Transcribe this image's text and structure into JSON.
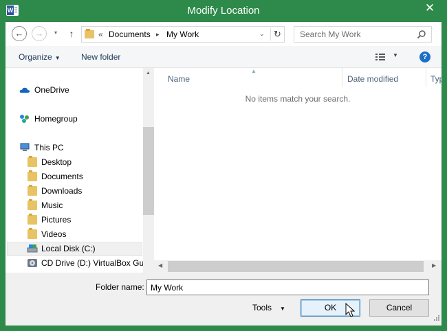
{
  "window": {
    "title": "Modify Location",
    "close_glyph": "✕",
    "app_icon": "word-icon",
    "accent": "#2e8a4a"
  },
  "navbar": {
    "back_glyph": "←",
    "forward_glyph": "→",
    "recent_glyph": "▾",
    "up_glyph": "↑",
    "address": {
      "chevron": "«",
      "crumb1": "Documents",
      "separator": "▸",
      "crumb2": "My Work",
      "dropdown_glyph": "⌄",
      "refresh_glyph": "↻"
    },
    "search": {
      "placeholder": "Search My Work"
    }
  },
  "toolbar": {
    "organize_label": "Organize",
    "caret": "▼",
    "new_folder_label": "New folder",
    "view_caret": "▼",
    "help_glyph": "?"
  },
  "nav_items": [
    {
      "label": "OneDrive",
      "icon": "cloud-icon"
    },
    {
      "label": "Homegroup",
      "icon": "homegroup-icon"
    },
    {
      "label": "This PC",
      "icon": "computer-icon"
    },
    {
      "label": "Desktop",
      "icon": "folder-icon"
    },
    {
      "label": "Documents",
      "icon": "folder-icon"
    },
    {
      "label": "Downloads",
      "icon": "folder-icon"
    },
    {
      "label": "Music",
      "icon": "folder-icon"
    },
    {
      "label": "Pictures",
      "icon": "folder-icon"
    },
    {
      "label": "Videos",
      "icon": "folder-icon"
    },
    {
      "label": "Local Disk (C:)",
      "icon": "drive-icon"
    },
    {
      "label": "CD Drive (D:) VirtualBox Gue",
      "icon": "cd-drive-icon"
    }
  ],
  "file_list": {
    "columns": [
      "Name",
      "Date modified",
      "Typ"
    ],
    "empty_message": "No items match your search."
  },
  "bottom": {
    "folder_name_label": "Folder name:",
    "folder_name_value": "My Work",
    "tools_label": "Tools",
    "tools_caret": "▼",
    "ok_label": "OK",
    "cancel_label": "Cancel"
  },
  "scroll_glyphs": {
    "up": "▲",
    "left": "◀",
    "right": "▶"
  }
}
